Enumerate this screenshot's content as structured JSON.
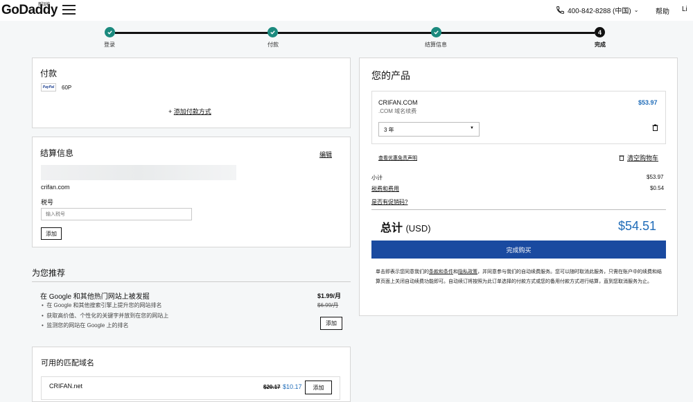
{
  "header": {
    "logo": "GoDaddy",
    "logo_sup": "新加坡",
    "phone": "400-842-8288 (中国)",
    "help": "帮助",
    "user": "Li"
  },
  "steps": [
    {
      "label": "登录"
    },
    {
      "label": "付款"
    },
    {
      "label": "结算信息"
    },
    {
      "label": "完成",
      "number": "4"
    }
  ],
  "payment": {
    "title": "付款",
    "method_badge": "PayPal",
    "method_text": "60P",
    "add_method": "+ 添加付款方式",
    "add_method_plus": "+",
    "add_method_link": "添加付款方式"
  },
  "billing": {
    "title": "结算信息",
    "edit": "编辑",
    "domain_line": "crifan.com",
    "tax_label": "税号",
    "tax_placeholder": "输入税号",
    "add_button": "添加"
  },
  "recommend": {
    "title": "为您推荐",
    "item_title": "在 Google 和其他热门网站上被发掘",
    "bullets": [
      "在 Google 和其他搜索引擎上提升您的网站排名",
      "获取高价值、个性化的关键字并放到在您的网站上",
      "监测您的网站在 Google 上的排名"
    ],
    "price": "$1.99/月",
    "old_price": "$6.99/月",
    "add_button": "添加"
  },
  "matching": {
    "title": "可用的匹配域名",
    "domain": "CRIFAN.net",
    "old_price": "$20.17",
    "price": "$10.17",
    "add_button": "添加"
  },
  "products": {
    "title": "您的产品",
    "item_name": "CRIFAN.COM",
    "item_sub": ".COM 域名续费",
    "item_price": "$53.97",
    "term": "3 年",
    "disclaimer_link": "查看优惠免责声明",
    "clear_cart": "清空购物车",
    "subtotal_label": "小计",
    "subtotal_value": "$53.97",
    "tax_label": "税费和费用",
    "tax_value": "$0.54",
    "promo": "是否有促销码?",
    "total_label": "总计",
    "total_currency": "(USD)",
    "total_value": "$54.51",
    "purchase_button": "完成购买",
    "terms_1": "单击即表示您同意我们的",
    "terms_link1": "条款和条件",
    "terms_2": "和",
    "terms_link2": "隐私政策",
    "terms_3": "，并同意参与我们的自动续费服务。您可以随时取消此服务，只需在账户中的续费和结算页面上关闭自动续费功能即可。自动续订将按照为此订单选择的付款方式或您的备用付款方式进行结算，直到您取消服务为止。"
  },
  "colors": {
    "step_green": "#1b8a7e",
    "primary_blue": "#1a4aa0",
    "price_blue": "#1e6bb8"
  }
}
